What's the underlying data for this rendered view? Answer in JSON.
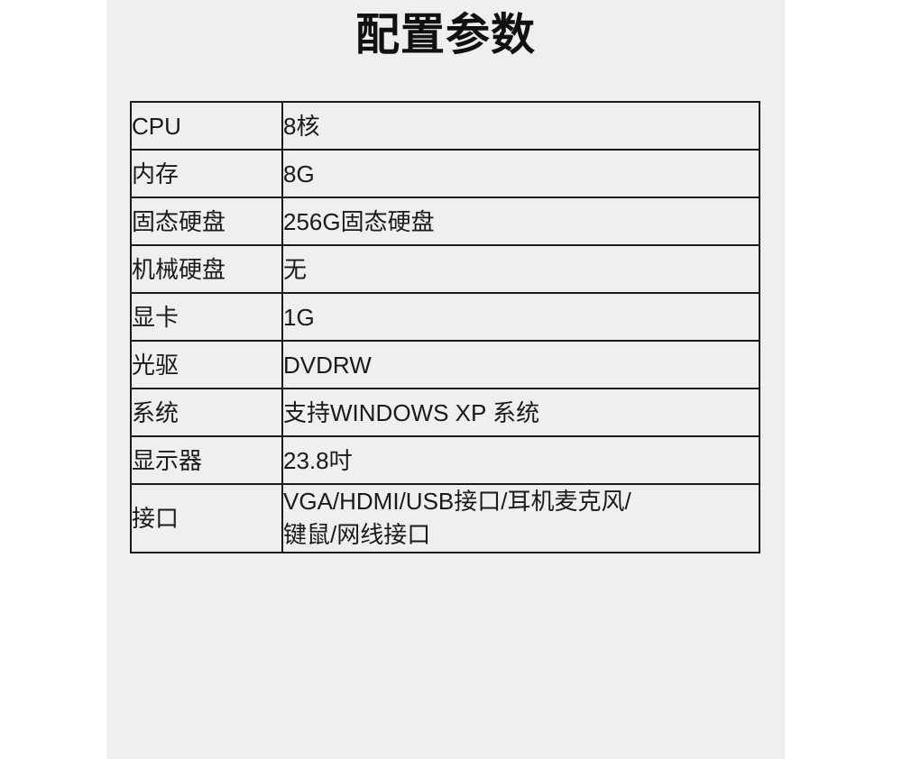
{
  "page": {
    "background_color": "#ffffff",
    "panel_color": "#efefef",
    "text_color": "#1a1a1a",
    "border_color": "#1a1a1a"
  },
  "title": "配置参数",
  "table": {
    "rows": [
      {
        "key": "CPU",
        "value_lines": [
          "8核"
        ]
      },
      {
        "key": "内存",
        "value_lines": [
          "8G"
        ]
      },
      {
        "key": "固态硬盘",
        "value_lines": [
          "256G固态硬盘"
        ]
      },
      {
        "key": "机械硬盘",
        "value_lines": [
          "无"
        ]
      },
      {
        "key": "显卡",
        "value_lines": [
          "1G"
        ]
      },
      {
        "key": "光驱",
        "value_lines": [
          "DVDRW"
        ]
      },
      {
        "key": "系统",
        "value_lines": [
          "支持WINDOWS XP 系统"
        ]
      },
      {
        "key": "显示器",
        "value_lines": [
          "23.8吋"
        ]
      },
      {
        "key": "接口",
        "value_lines": [
          "VGA/HDMI/USB接口/耳机麦克风/",
          "键鼠/网线接口"
        ]
      }
    ]
  }
}
